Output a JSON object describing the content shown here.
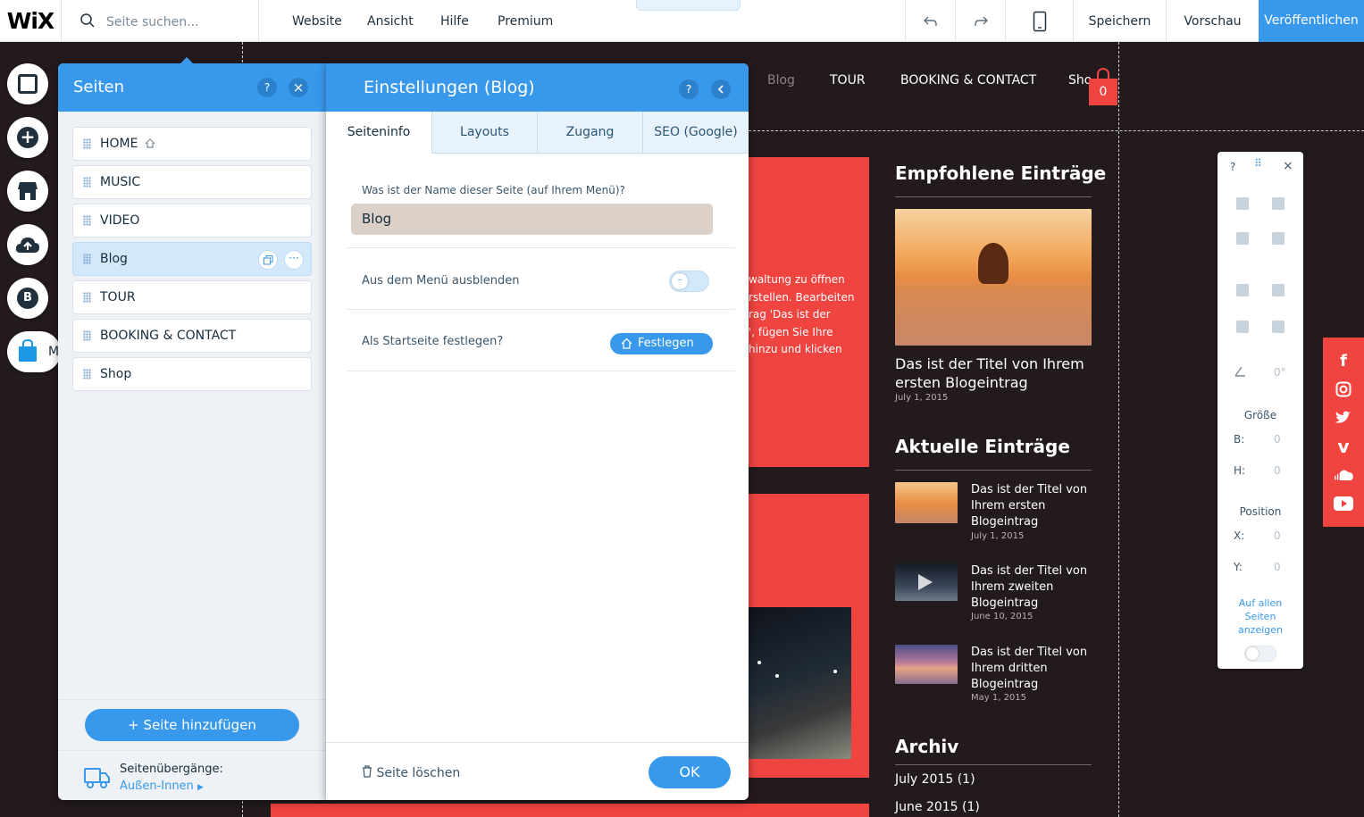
{
  "topbar": {
    "logo": "WiX",
    "search_placeholder": "Seite suchen...",
    "menu": [
      "Website",
      "Ansicht",
      "Hilfe",
      "Premium"
    ],
    "save": "Speichern",
    "preview": "Vorschau",
    "publish": "Veröffentlichen",
    "handle": "˄"
  },
  "site": {
    "nav": [
      "Blog",
      "TOUR",
      "BOOKING & CONTACT",
      "Sho"
    ],
    "cart_count": "0",
    "body_text": [
      "waltung zu öffnen",
      "rstellen. Bearbeiten",
      "rag 'Das ist der",
      "', fügen Sie Ihre",
      " hinzu und klicken"
    ],
    "featured_heading": "Empfohlene Einträge",
    "featured_title": "Das ist der Titel von Ihrem ersten Blogeintrag",
    "featured_date": "July 1, 2015",
    "recent_heading": "Aktuelle Einträge",
    "recent": [
      {
        "title": "Das ist der Titel von Ihrem ersten Blogeintrag",
        "date": "July 1, 2015"
      },
      {
        "title": "Das ist der Titel von Ihrem zweiten Blogeintrag",
        "date": "June 10, 2015"
      },
      {
        "title": "Das ist der Titel von Ihrem dritten Blogeintrag",
        "date": "May 1, 2015"
      }
    ],
    "archive_heading": "Archiv",
    "archive": [
      "July 2015 (1)",
      "June 2015 (1)"
    ],
    "rail_badge": "B",
    "rail_label": "M"
  },
  "pages_panel": {
    "title": "Seiten",
    "help": "?",
    "close": "×",
    "items": [
      "HOME",
      "MUSIC",
      "VIDEO",
      "Blog",
      "TOUR",
      "BOOKING & CONTACT",
      "Shop"
    ],
    "add_page": "+ Seite hinzufügen",
    "transitions_label": "Seitenübergänge:",
    "transitions_value": "Außen-Innen"
  },
  "settings_panel": {
    "title": "Einstellungen (Blog)",
    "help": "?",
    "tabs": [
      "Seiteninfo",
      "Layouts",
      "Zugang",
      "SEO (Google)"
    ],
    "name_question": "Was ist der Name dieser Seite (auf Ihrem Menü)?",
    "name_value": "Blog",
    "hide_label": "Aus dem Menü ausblenden",
    "hide_toggle": false,
    "home_label": "Als Startseite festlegen?",
    "home_button": "Festlegen",
    "delete": "Seite löschen",
    "ok": "OK"
  },
  "toolbar": {
    "help": "?",
    "close": "×",
    "angle": "0°",
    "size_heading": "Größe",
    "w_label": "B:",
    "w_value": "0",
    "h_label": "H:",
    "h_value": "0",
    "position_heading": "Position",
    "x_label": "X:",
    "x_value": "0",
    "y_label": "Y:",
    "y_value": "0",
    "show_all": "Auf allen Seiten anzeigen",
    "show_all_toggle": false
  },
  "colors": {
    "accent": "#3899ec",
    "brand_red": "#f04440",
    "site_bg": "#231a1d"
  }
}
